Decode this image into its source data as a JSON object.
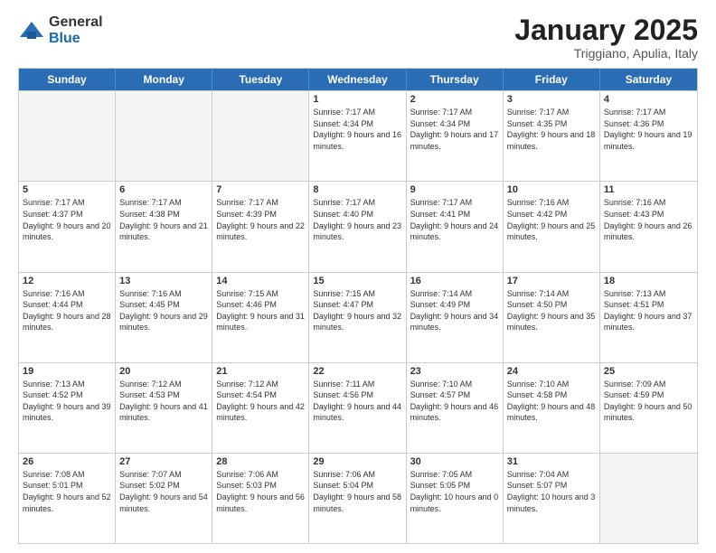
{
  "logo": {
    "general": "General",
    "blue": "Blue"
  },
  "title": "January 2025",
  "location": "Triggiano, Apulia, Italy",
  "days": [
    "Sunday",
    "Monday",
    "Tuesday",
    "Wednesday",
    "Thursday",
    "Friday",
    "Saturday"
  ],
  "rows": [
    [
      {
        "day": "",
        "empty": true
      },
      {
        "day": "",
        "empty": true
      },
      {
        "day": "",
        "empty": true
      },
      {
        "day": "1",
        "sunrise": "Sunrise: 7:17 AM",
        "sunset": "Sunset: 4:34 PM",
        "daylight": "Daylight: 9 hours and 16 minutes."
      },
      {
        "day": "2",
        "sunrise": "Sunrise: 7:17 AM",
        "sunset": "Sunset: 4:34 PM",
        "daylight": "Daylight: 9 hours and 17 minutes."
      },
      {
        "day": "3",
        "sunrise": "Sunrise: 7:17 AM",
        "sunset": "Sunset: 4:35 PM",
        "daylight": "Daylight: 9 hours and 18 minutes."
      },
      {
        "day": "4",
        "sunrise": "Sunrise: 7:17 AM",
        "sunset": "Sunset: 4:36 PM",
        "daylight": "Daylight: 9 hours and 19 minutes."
      }
    ],
    [
      {
        "day": "5",
        "sunrise": "Sunrise: 7:17 AM",
        "sunset": "Sunset: 4:37 PM",
        "daylight": "Daylight: 9 hours and 20 minutes."
      },
      {
        "day": "6",
        "sunrise": "Sunrise: 7:17 AM",
        "sunset": "Sunset: 4:38 PM",
        "daylight": "Daylight: 9 hours and 21 minutes."
      },
      {
        "day": "7",
        "sunrise": "Sunrise: 7:17 AM",
        "sunset": "Sunset: 4:39 PM",
        "daylight": "Daylight: 9 hours and 22 minutes."
      },
      {
        "day": "8",
        "sunrise": "Sunrise: 7:17 AM",
        "sunset": "Sunset: 4:40 PM",
        "daylight": "Daylight: 9 hours and 23 minutes."
      },
      {
        "day": "9",
        "sunrise": "Sunrise: 7:17 AM",
        "sunset": "Sunset: 4:41 PM",
        "daylight": "Daylight: 9 hours and 24 minutes."
      },
      {
        "day": "10",
        "sunrise": "Sunrise: 7:16 AM",
        "sunset": "Sunset: 4:42 PM",
        "daylight": "Daylight: 9 hours and 25 minutes."
      },
      {
        "day": "11",
        "sunrise": "Sunrise: 7:16 AM",
        "sunset": "Sunset: 4:43 PM",
        "daylight": "Daylight: 9 hours and 26 minutes."
      }
    ],
    [
      {
        "day": "12",
        "sunrise": "Sunrise: 7:16 AM",
        "sunset": "Sunset: 4:44 PM",
        "daylight": "Daylight: 9 hours and 28 minutes."
      },
      {
        "day": "13",
        "sunrise": "Sunrise: 7:16 AM",
        "sunset": "Sunset: 4:45 PM",
        "daylight": "Daylight: 9 hours and 29 minutes."
      },
      {
        "day": "14",
        "sunrise": "Sunrise: 7:15 AM",
        "sunset": "Sunset: 4:46 PM",
        "daylight": "Daylight: 9 hours and 31 minutes."
      },
      {
        "day": "15",
        "sunrise": "Sunrise: 7:15 AM",
        "sunset": "Sunset: 4:47 PM",
        "daylight": "Daylight: 9 hours and 32 minutes."
      },
      {
        "day": "16",
        "sunrise": "Sunrise: 7:14 AM",
        "sunset": "Sunset: 4:49 PM",
        "daylight": "Daylight: 9 hours and 34 minutes."
      },
      {
        "day": "17",
        "sunrise": "Sunrise: 7:14 AM",
        "sunset": "Sunset: 4:50 PM",
        "daylight": "Daylight: 9 hours and 35 minutes."
      },
      {
        "day": "18",
        "sunrise": "Sunrise: 7:13 AM",
        "sunset": "Sunset: 4:51 PM",
        "daylight": "Daylight: 9 hours and 37 minutes."
      }
    ],
    [
      {
        "day": "19",
        "sunrise": "Sunrise: 7:13 AM",
        "sunset": "Sunset: 4:52 PM",
        "daylight": "Daylight: 9 hours and 39 minutes."
      },
      {
        "day": "20",
        "sunrise": "Sunrise: 7:12 AM",
        "sunset": "Sunset: 4:53 PM",
        "daylight": "Daylight: 9 hours and 41 minutes."
      },
      {
        "day": "21",
        "sunrise": "Sunrise: 7:12 AM",
        "sunset": "Sunset: 4:54 PM",
        "daylight": "Daylight: 9 hours and 42 minutes."
      },
      {
        "day": "22",
        "sunrise": "Sunrise: 7:11 AM",
        "sunset": "Sunset: 4:56 PM",
        "daylight": "Daylight: 9 hours and 44 minutes."
      },
      {
        "day": "23",
        "sunrise": "Sunrise: 7:10 AM",
        "sunset": "Sunset: 4:57 PM",
        "daylight": "Daylight: 9 hours and 46 minutes."
      },
      {
        "day": "24",
        "sunrise": "Sunrise: 7:10 AM",
        "sunset": "Sunset: 4:58 PM",
        "daylight": "Daylight: 9 hours and 48 minutes."
      },
      {
        "day": "25",
        "sunrise": "Sunrise: 7:09 AM",
        "sunset": "Sunset: 4:59 PM",
        "daylight": "Daylight: 9 hours and 50 minutes."
      }
    ],
    [
      {
        "day": "26",
        "sunrise": "Sunrise: 7:08 AM",
        "sunset": "Sunset: 5:01 PM",
        "daylight": "Daylight: 9 hours and 52 minutes."
      },
      {
        "day": "27",
        "sunrise": "Sunrise: 7:07 AM",
        "sunset": "Sunset: 5:02 PM",
        "daylight": "Daylight: 9 hours and 54 minutes."
      },
      {
        "day": "28",
        "sunrise": "Sunrise: 7:06 AM",
        "sunset": "Sunset: 5:03 PM",
        "daylight": "Daylight: 9 hours and 56 minutes."
      },
      {
        "day": "29",
        "sunrise": "Sunrise: 7:06 AM",
        "sunset": "Sunset: 5:04 PM",
        "daylight": "Daylight: 9 hours and 58 minutes."
      },
      {
        "day": "30",
        "sunrise": "Sunrise: 7:05 AM",
        "sunset": "Sunset: 5:05 PM",
        "daylight": "Daylight: 10 hours and 0 minutes."
      },
      {
        "day": "31",
        "sunrise": "Sunrise: 7:04 AM",
        "sunset": "Sunset: 5:07 PM",
        "daylight": "Daylight: 10 hours and 3 minutes."
      },
      {
        "day": "",
        "empty": true
      }
    ]
  ]
}
